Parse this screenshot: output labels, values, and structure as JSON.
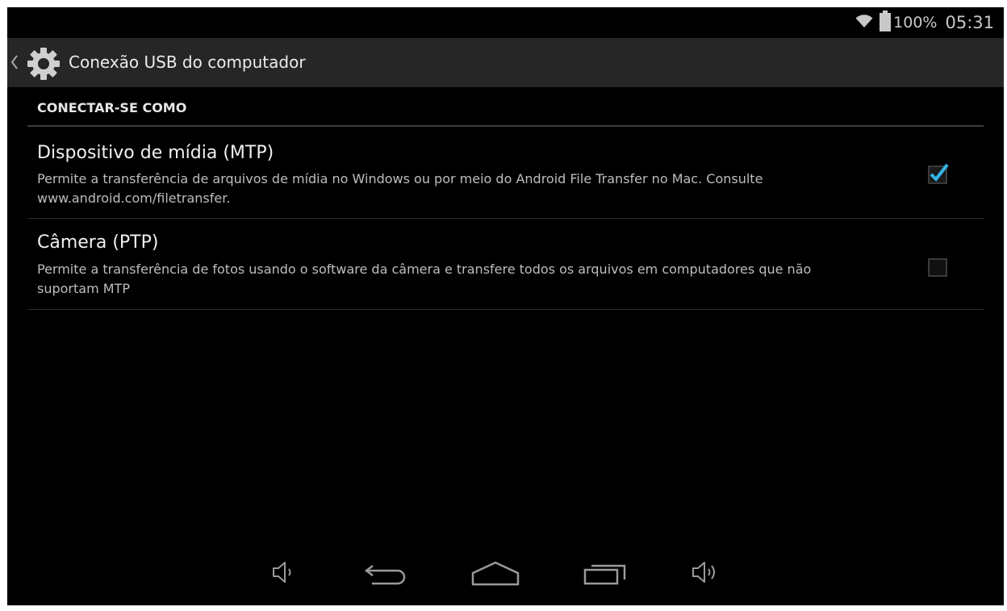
{
  "status_bar": {
    "battery_text": "100%",
    "time": "05:31",
    "icons": [
      "wifi-icon",
      "battery-icon"
    ]
  },
  "action_bar": {
    "title": "Conexão USB do computador",
    "icons": [
      "up-caret-icon",
      "settings-gear-icon"
    ]
  },
  "section": {
    "header": "CONECTAR-SE COMO"
  },
  "options": [
    {
      "title": "Dispositivo de mídia (MTP)",
      "summary": "Permite a transferência de arquivos de mídia no Windows ou por meio do Android File Transfer no Mac. Consulte www.android.com/filetransfer.",
      "checked": true
    },
    {
      "title": "Câmera (PTP)",
      "summary": "Permite a transferência de fotos usando o software da câmera e transfere todos os arquivos em computadores que não suportam MTP",
      "checked": false
    }
  ],
  "nav_bar": {
    "buttons": [
      "volume-down-icon",
      "back-icon",
      "home-icon",
      "recent-apps-icon",
      "volume-up-icon"
    ]
  },
  "colors": {
    "accent_check": "#33b5e5",
    "background": "#000000",
    "action_bar": "#262626"
  }
}
